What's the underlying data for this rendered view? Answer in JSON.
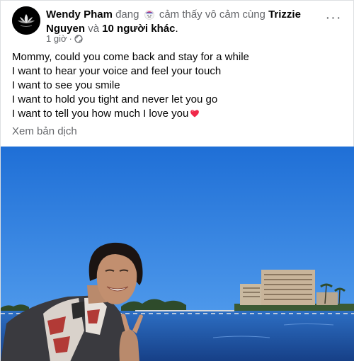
{
  "post": {
    "author": "Wendy Pham",
    "verb": "đang",
    "feeling": "cảm thấy vô cảm cùng",
    "tagged_first": "Trizzie",
    "tagged_first_last": "Nguyen",
    "conjunction": "và",
    "tagged_others": "10 người khác",
    "period": ".",
    "time": "1 giờ",
    "separator": "·",
    "privacy_icon": "globe-icon",
    "more_icon": "more-options-icon",
    "more_label": "···",
    "lines": [
      "Mommy, could you come back and stay for a while",
      "I want to hear your voice and feel your touch",
      "I want to see you smile",
      "I want to hold you tight and never let you go",
      "I want to tell you how much I love you"
    ],
    "line_end_emoji": "heart-icon",
    "translate_label": "Xem bản dịch"
  },
  "colors": {
    "text": "#050505",
    "secondary": "#65676b",
    "heart": "#f02849",
    "sky": "#2f7fe0",
    "water": "#2260b3"
  }
}
